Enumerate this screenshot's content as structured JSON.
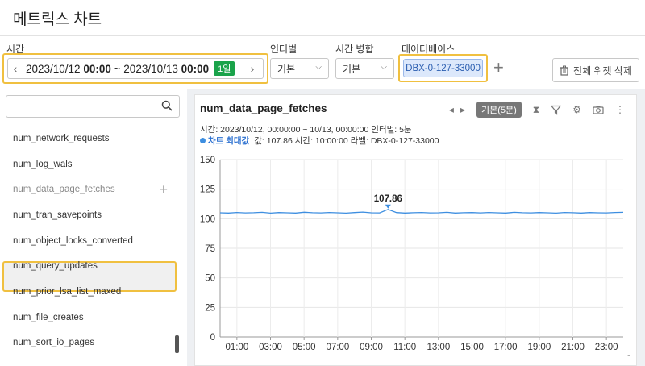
{
  "page_title": "메트릭스 차트",
  "labels": {
    "time": "시간",
    "interval": "인터벌",
    "merge": "시간 병합",
    "database": "데이터베이스"
  },
  "time_range": {
    "start_date": "2023/10/12",
    "start_time": "00:00",
    "sep": "~",
    "end_date": "2023/10/13",
    "end_time": "00:00",
    "badge": "1일"
  },
  "interval_select": "기본",
  "merge_select": "기본",
  "db_chip": "DBX-0-127-33000",
  "delete_all_label": "전체 위젯 삭제",
  "search": {
    "placeholder": ""
  },
  "metrics": [
    "num_network_requests",
    "num_log_wals",
    "num_data_page_fetches",
    "num_tran_savepoints",
    "num_object_locks_converted",
    "num_query_updates",
    "num_prior_lsa_list_maxed",
    "num_file_creates",
    "num_sort_io_pages"
  ],
  "widget": {
    "title": "num_data_page_fetches",
    "mode_chip": "기본(5분)",
    "info_line": "시간: 2023/10/12, 00:00:00 ~ 10/13, 00:00:00   인터벌: 5분",
    "legend_label": "차트 최대값",
    "legend_detail": "값: 107.86   시간: 10:00:00   라벨: DBX-0-127-33000"
  },
  "chart_data": {
    "type": "line",
    "xlabel": "",
    "ylabel": "",
    "ylim": [
      0,
      150
    ],
    "yticks": [
      0,
      25,
      50,
      75,
      100,
      125,
      150
    ],
    "xticks": [
      "01:00",
      "03:00",
      "05:00",
      "07:00",
      "09:00",
      "11:00",
      "13:00",
      "15:00",
      "17:00",
      "19:00",
      "21:00",
      "23:00"
    ],
    "grid": true,
    "series": [
      {
        "color": "#3d8ee0",
        "x_hours": [
          0,
          0.5,
          1,
          1.5,
          2,
          2.5,
          3,
          3.5,
          4,
          4.5,
          5,
          5.5,
          6,
          6.5,
          7,
          7.5,
          8,
          8.5,
          9,
          9.5,
          10,
          10.5,
          11,
          11.5,
          12,
          12.5,
          13,
          13.5,
          14,
          14.5,
          15,
          15.5,
          16,
          16.5,
          17,
          17.5,
          18,
          18.5,
          19,
          19.5,
          20,
          20.5,
          21,
          21.5,
          22,
          22.5,
          23,
          23.5,
          24
        ],
        "values": [
          105,
          104.8,
          105.3,
          104.9,
          105.1,
          105.4,
          104.7,
          105.2,
          105.0,
          104.8,
          105.5,
          105.1,
          104.9,
          105.3,
          105.0,
          104.7,
          105.2,
          105.6,
          105.0,
          104.9,
          107.86,
          105.2,
          104.8,
          105.1,
          105.3,
          104.9,
          105.0,
          105.4,
          104.8,
          105.1,
          105.2,
          104.9,
          105.3,
          105.0,
          104.8,
          105.4,
          105.1,
          104.9,
          105.2,
          105.0,
          104.7,
          105.3,
          105.1,
          104.8,
          105.2,
          105.0,
          104.9,
          105.3,
          105.4
        ]
      }
    ],
    "annotation": {
      "label": "107.86",
      "x_hour": 10,
      "value": 107.86
    }
  }
}
